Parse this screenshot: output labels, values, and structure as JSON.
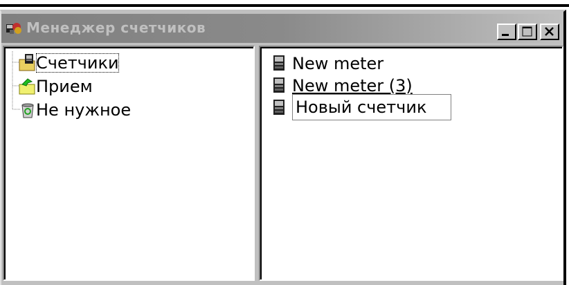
{
  "window": {
    "title": "Менеджер счетчиков",
    "controls": {
      "minimize": "minimize",
      "maximize": "maximize",
      "close": "close"
    }
  },
  "tree": {
    "items": [
      {
        "label": "Счетчики",
        "icon": "meter-folder-icon",
        "selected": true
      },
      {
        "label": "Прием",
        "icon": "inbox-folder-icon"
      },
      {
        "label": "Не нужное",
        "icon": "recycle-bin-icon"
      }
    ]
  },
  "list": {
    "items": [
      {
        "label": "New meter",
        "icon": "meter-icon"
      },
      {
        "label": "New meter (3)",
        "icon": "meter-icon"
      }
    ],
    "rename_item": {
      "value": "Новый счетчик",
      "icon": "meter-icon"
    }
  },
  "colors": {
    "face": "#c0c0c0",
    "title_inactive_start": "#808080",
    "title_inactive_end": "#c0c0c0"
  }
}
